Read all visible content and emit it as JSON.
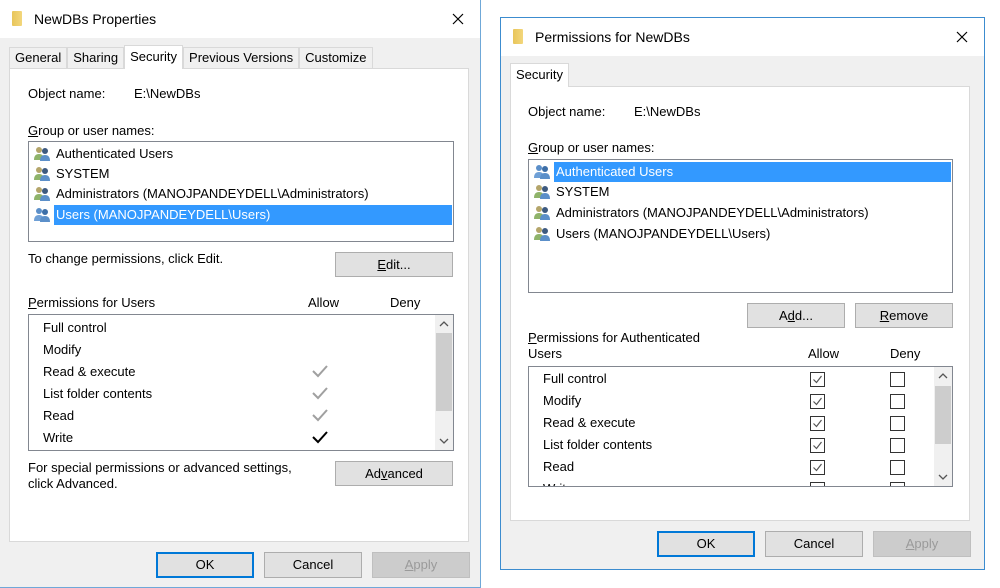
{
  "properties_dialog": {
    "title": "NewDBs Properties",
    "tabs": [
      {
        "label": "General",
        "active": false
      },
      {
        "label": "Sharing",
        "active": false
      },
      {
        "label": "Security",
        "active": true
      },
      {
        "label": "Previous Versions",
        "active": false
      },
      {
        "label": "Customize",
        "active": false
      }
    ],
    "object_name_label": "Object name:",
    "object_name_value": "E:\\NewDBs",
    "group_label_prefix": "G",
    "group_label_rest": "roup or user names:",
    "groups": [
      {
        "name": "Authenticated Users",
        "selected": false
      },
      {
        "name": "SYSTEM",
        "selected": false
      },
      {
        "name": "Administrators (MANOJPANDEYDELL\\Administrators)",
        "selected": false
      },
      {
        "name": "Users (MANOJPANDEYDELL\\Users)",
        "selected": true
      }
    ],
    "change_hint": "To change permissions, click Edit.",
    "edit_button_accel": "E",
    "edit_button_rest": "dit...",
    "permissions_label_prefix": "P",
    "permissions_label_rest": "ermissions for Users",
    "allow_header": "Allow",
    "deny_header": "Deny",
    "permissions": [
      {
        "name": "Full control",
        "allow": "none",
        "deny": "none"
      },
      {
        "name": "Modify",
        "allow": "none",
        "deny": "none"
      },
      {
        "name": "Read & execute",
        "allow": "inherited",
        "deny": "none"
      },
      {
        "name": "List folder contents",
        "allow": "inherited",
        "deny": "none"
      },
      {
        "name": "Read",
        "allow": "inherited",
        "deny": "none"
      },
      {
        "name": "Write",
        "allow": "explicit",
        "deny": "none"
      }
    ],
    "advanced_hint_line1": "For special permissions or advanced settings,",
    "advanced_hint_line2": "click Advanced.",
    "advanced_button_pre": "Ad",
    "advanced_button_accel": "v",
    "advanced_button_post": "anced",
    "ok_label": "OK",
    "cancel_label": "Cancel",
    "apply_accel": "A",
    "apply_rest": "pply"
  },
  "permissions_dialog": {
    "title": "Permissions for NewDBs",
    "tab_label": "Security",
    "object_name_label": "Object name:",
    "object_name_value": "E:\\NewDBs",
    "group_label_prefix": "G",
    "group_label_rest": "roup or user names:",
    "groups": [
      {
        "name": "Authenticated Users",
        "selected": true
      },
      {
        "name": "SYSTEM",
        "selected": false
      },
      {
        "name": "Administrators (MANOJPANDEYDELL\\Administrators)",
        "selected": false
      },
      {
        "name": "Users (MANOJPANDEYDELL\\Users)",
        "selected": false
      }
    ],
    "add_button_pre": "A",
    "add_button_accel": "d",
    "add_button_post": "d...",
    "remove_button_accel": "R",
    "remove_button_rest": "emove",
    "permissions_label_prefix": "P",
    "permissions_label_line1_rest": "ermissions for Authenticated",
    "permissions_label_line2": "Users",
    "allow_header": "Allow",
    "deny_header": "Deny",
    "permissions": [
      {
        "name": "Full control",
        "allow": true,
        "deny": false
      },
      {
        "name": "Modify",
        "allow": true,
        "deny": false
      },
      {
        "name": "Read & execute",
        "allow": true,
        "deny": false
      },
      {
        "name": "List folder contents",
        "allow": true,
        "deny": false
      },
      {
        "name": "Read",
        "allow": true,
        "deny": false
      },
      {
        "name": "Write",
        "allow": false,
        "deny": false
      }
    ],
    "ok_label": "OK",
    "cancel_label": "Cancel",
    "apply_accel": "A",
    "apply_rest": "pply"
  },
  "icons": {
    "title_icon": "folder-icon",
    "close": "close-icon",
    "group": "user-group-icon",
    "scroll_up": "chevron-up-icon",
    "scroll_down": "chevron-down-icon"
  },
  "colors": {
    "selection": "#3399ff",
    "default_button_border": "#0078d7",
    "window_border": "#3c8ccf",
    "inherited_check": "#a0a0a0",
    "explicit_check": "#000000"
  }
}
